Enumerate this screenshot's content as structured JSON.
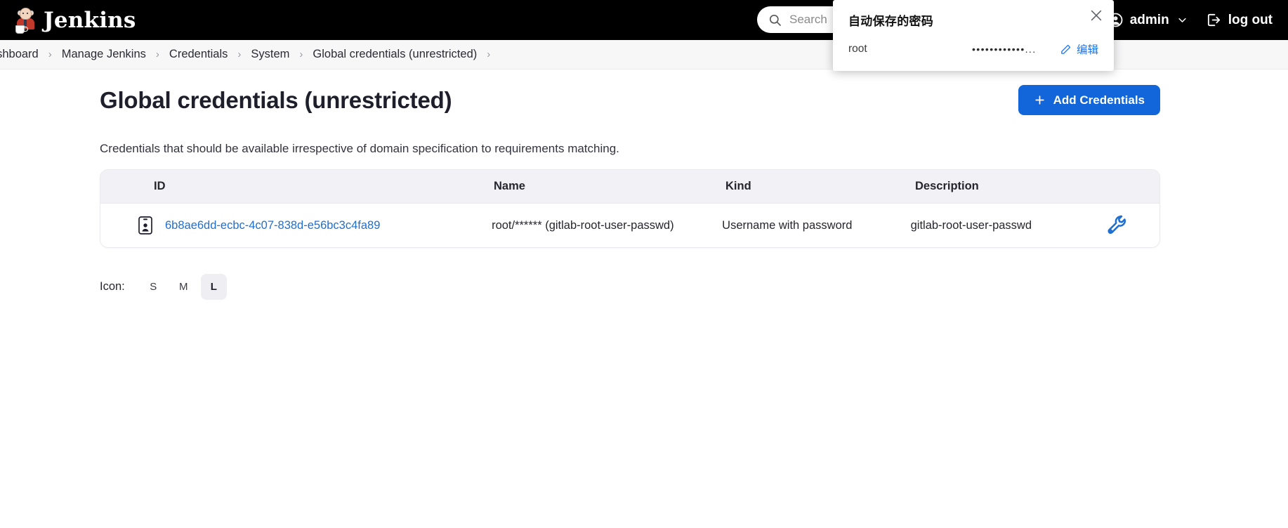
{
  "header": {
    "brand_name": "Jenkins",
    "logo_icon": "jenkins-butler-logo",
    "search": {
      "icon": "search-icon",
      "placeholder": "Search"
    },
    "user": {
      "icon": "user-circle-icon",
      "label": "admin",
      "chevron": "chevron-down-icon"
    },
    "logout": {
      "icon": "logout-icon",
      "label": "log out"
    }
  },
  "breadcrumb": {
    "items": [
      {
        "label": "Dashboard"
      },
      {
        "label": "Manage Jenkins"
      },
      {
        "label": "Credentials"
      },
      {
        "label": "System"
      },
      {
        "label": "Global credentials (unrestricted)"
      }
    ],
    "separator": "›"
  },
  "main": {
    "page_title": "Global credentials (unrestricted)",
    "add_button": {
      "label": "Add Credentials",
      "icon": "plus-icon",
      "color": "#1366d9"
    },
    "intro_text": "Credentials that should be available irrespective of domain specification to requirements matching.",
    "table": {
      "columns": [
        "ID",
        "Name",
        "Kind",
        "Description"
      ],
      "rows": [
        {
          "icon": "credential-badge-icon",
          "id": "6b8ae6dd-ecbc-4c07-838d-e56bc3c4fa89",
          "name": "root/****** (gitlab-root-user-passwd)",
          "kind": "Username with password",
          "description": "gitlab-root-user-passwd",
          "action_icon": "wrench-icon"
        }
      ]
    },
    "icon_size": {
      "label": "Icon:",
      "options": [
        "S",
        "M",
        "L"
      ],
      "selected": "L"
    }
  },
  "password_popup": {
    "title": "自动保存的密码",
    "username": "root",
    "password_masked": "••••••••••••...",
    "edit_label": "编辑",
    "edit_icon": "pencil-icon",
    "close_icon": "close-icon",
    "link_color": "#1a73e8"
  }
}
